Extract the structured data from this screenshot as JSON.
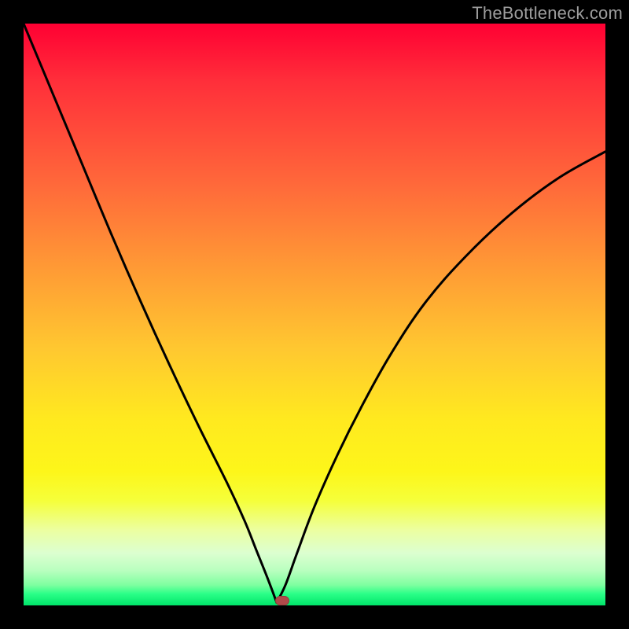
{
  "watermark": "TheBottleneck.com",
  "colors": {
    "frame": "#000000",
    "curve_stroke": "#000000",
    "marker_fill": "#b04a4a"
  },
  "chart_data": {
    "type": "line",
    "title": "",
    "xlabel": "",
    "ylabel": "",
    "xlim": [
      0,
      100
    ],
    "ylim": [
      0,
      100
    ],
    "grid": false,
    "legend": false,
    "series": [
      {
        "name": "left-branch",
        "x": [
          0,
          5,
          10,
          15,
          20,
          25,
          30,
          35,
          38,
          40,
          42,
          43.5
        ],
        "values": [
          100,
          88,
          76,
          64,
          52.5,
          41.5,
          31,
          21,
          14.5,
          9.5,
          4.5,
          0.5
        ]
      },
      {
        "name": "right-branch",
        "x": [
          43.5,
          45,
          47,
          50,
          54,
          58,
          63,
          69,
          76,
          84,
          92,
          100
        ],
        "values": [
          0.5,
          3.5,
          9,
          17,
          26,
          34,
          43,
          52,
          60,
          67.5,
          73.5,
          78
        ]
      }
    ],
    "marker": {
      "x": 44.5,
      "y": 0.8
    }
  }
}
